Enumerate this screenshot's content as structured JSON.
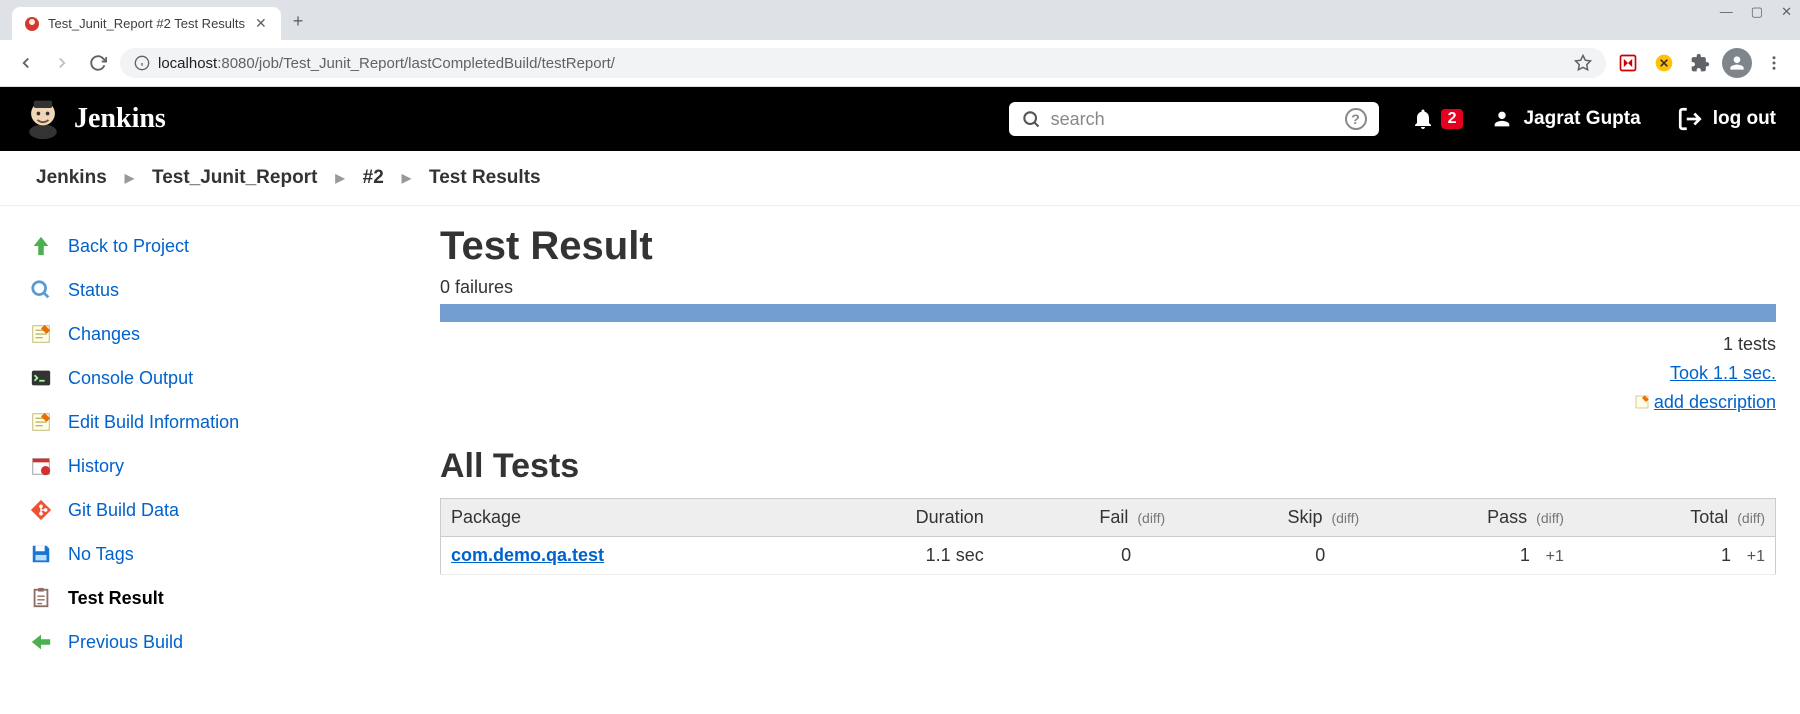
{
  "browser": {
    "tab_title": "Test_Junit_Report #2 Test Results",
    "url_host": "localhost",
    "url_port": ":8080",
    "url_path": "/job/Test_Junit_Report/lastCompletedBuild/testReport/"
  },
  "header": {
    "logo_text": "Jenkins",
    "search_placeholder": "search",
    "notif_count": "2",
    "user_name": "Jagrat Gupta",
    "logout_label": "log out"
  },
  "breadcrumb": {
    "items": [
      "Jenkins",
      "Test_Junit_Report",
      "#2",
      "Test Results"
    ]
  },
  "sidebar": {
    "items": [
      {
        "label": "Back to Project"
      },
      {
        "label": "Status"
      },
      {
        "label": "Changes"
      },
      {
        "label": "Console Output"
      },
      {
        "label": "Edit Build Information"
      },
      {
        "label": "History"
      },
      {
        "label": "Git Build Data"
      },
      {
        "label": "No Tags"
      },
      {
        "label": "Test Result"
      },
      {
        "label": "Previous Build"
      }
    ]
  },
  "main": {
    "title": "Test Result",
    "failures_text": "0 failures",
    "tests_count": "1 tests",
    "took_text": "Took 1.1 sec.",
    "add_desc": "add description",
    "all_tests_title": "All Tests",
    "columns": {
      "package": "Package",
      "duration": "Duration",
      "fail": "Fail",
      "skip": "Skip",
      "pass": "Pass",
      "total": "Total",
      "diff": "(diff)"
    },
    "rows": [
      {
        "package": "com.demo.qa.test",
        "duration": "1.1 sec",
        "fail": "0",
        "fail_diff": "",
        "skip": "0",
        "skip_diff": "",
        "pass": "1",
        "pass_diff": "+1",
        "total": "1",
        "total_diff": "+1"
      }
    ]
  }
}
